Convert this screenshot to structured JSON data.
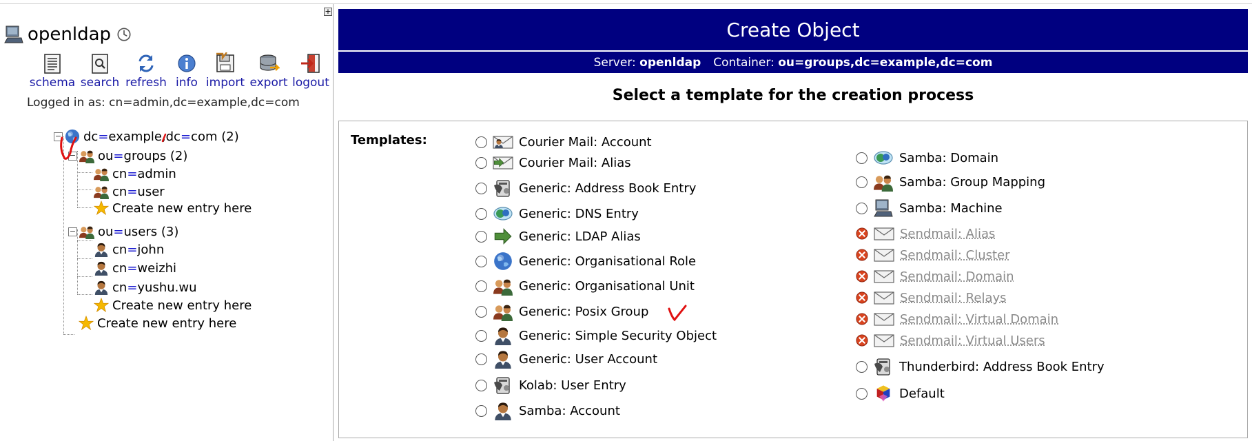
{
  "server": {
    "name": "openldap"
  },
  "toolbar": [
    {
      "label": "schema",
      "icon": "schema-icon"
    },
    {
      "label": "search",
      "icon": "search-icon"
    },
    {
      "label": "refresh",
      "icon": "refresh-icon"
    },
    {
      "label": "info",
      "icon": "info-icon"
    },
    {
      "label": "import",
      "icon": "import-icon"
    },
    {
      "label": "export",
      "icon": "export-icon"
    },
    {
      "label": "logout",
      "icon": "logout-icon"
    }
  ],
  "logged_in": "Logged in as: cn=admin,dc=example,dc=com",
  "tree": {
    "root": {
      "a": "dc",
      "b": "example",
      "c": ",dc",
      "d": "com",
      "count": "(2)"
    },
    "groups": {
      "a": "ou",
      "b": "groups",
      "count": "(2)"
    },
    "groups_children": [
      {
        "a": "cn",
        "b": "admin"
      },
      {
        "a": "cn",
        "b": "user"
      }
    ],
    "users": {
      "a": "ou",
      "b": "users",
      "count": "(3)"
    },
    "users_children": [
      {
        "a": "cn",
        "b": "john"
      },
      {
        "a": "cn",
        "b": "weizhi"
      },
      {
        "a": "cn",
        "b": "yushu.wu"
      }
    ],
    "create_new": "Create new entry here"
  },
  "header": {
    "title": "Create Object",
    "server_label": "Server:",
    "server_value": "openldap",
    "container_label": "Container:",
    "container_value": "ou=groups,dc=example,dc=com"
  },
  "select_heading": "Select a template for the creation process",
  "templates_label": "Templates:",
  "templates_left": [
    {
      "label": "Courier Mail: Account",
      "icon": "courier-account-icon"
    },
    {
      "label": "Courier Mail: Alias",
      "icon": "courier-alias-icon"
    },
    {
      "label": "Generic: Address Book Entry",
      "icon": "address-book-icon"
    },
    {
      "label": "Generic: DNS Entry",
      "icon": "dns-icon"
    },
    {
      "label": "Generic: LDAP Alias",
      "icon": "arrow-icon"
    },
    {
      "label": "Generic: Organisational Role",
      "icon": "globe-icon"
    },
    {
      "label": "Generic: Organisational Unit",
      "icon": "group-icon"
    },
    {
      "label": "Generic: Posix Group",
      "icon": "group-icon"
    },
    {
      "label": "Generic: Simple Security Object",
      "icon": "user-icon"
    },
    {
      "label": "Generic: User Account",
      "icon": "user-icon"
    },
    {
      "label": "Kolab: User Entry",
      "icon": "address-book-icon"
    },
    {
      "label": "Samba: Account",
      "icon": "user-icon"
    }
  ],
  "templates_right": [
    {
      "label": "Samba: Domain",
      "icon": "dns-icon",
      "enabled": true
    },
    {
      "label": "Samba: Group Mapping",
      "icon": "group-icon",
      "enabled": true
    },
    {
      "label": "Samba: Machine",
      "icon": "computer-icon",
      "enabled": true
    },
    {
      "label": "Sendmail: Alias",
      "icon": "mail-icon",
      "enabled": false
    },
    {
      "label": "Sendmail: Cluster",
      "icon": "mail-icon",
      "enabled": false
    },
    {
      "label": "Sendmail: Domain",
      "icon": "mail-icon",
      "enabled": false
    },
    {
      "label": "Sendmail: Relays",
      "icon": "mail-icon",
      "enabled": false
    },
    {
      "label": "Sendmail: Virtual Domain",
      "icon": "mail-icon",
      "enabled": false
    },
    {
      "label": "Sendmail: Virtual Users",
      "icon": "mail-icon",
      "enabled": false
    },
    {
      "label": "Thunderbird: Address Book Entry",
      "icon": "address-book-icon",
      "enabled": true
    },
    {
      "label": "Default",
      "icon": "default-icon",
      "enabled": true
    }
  ],
  "colors": {
    "header_bg": "#000080",
    "link": "#1a1aa6",
    "disabled": "#8a8a8a",
    "annotation": "#e01010"
  }
}
